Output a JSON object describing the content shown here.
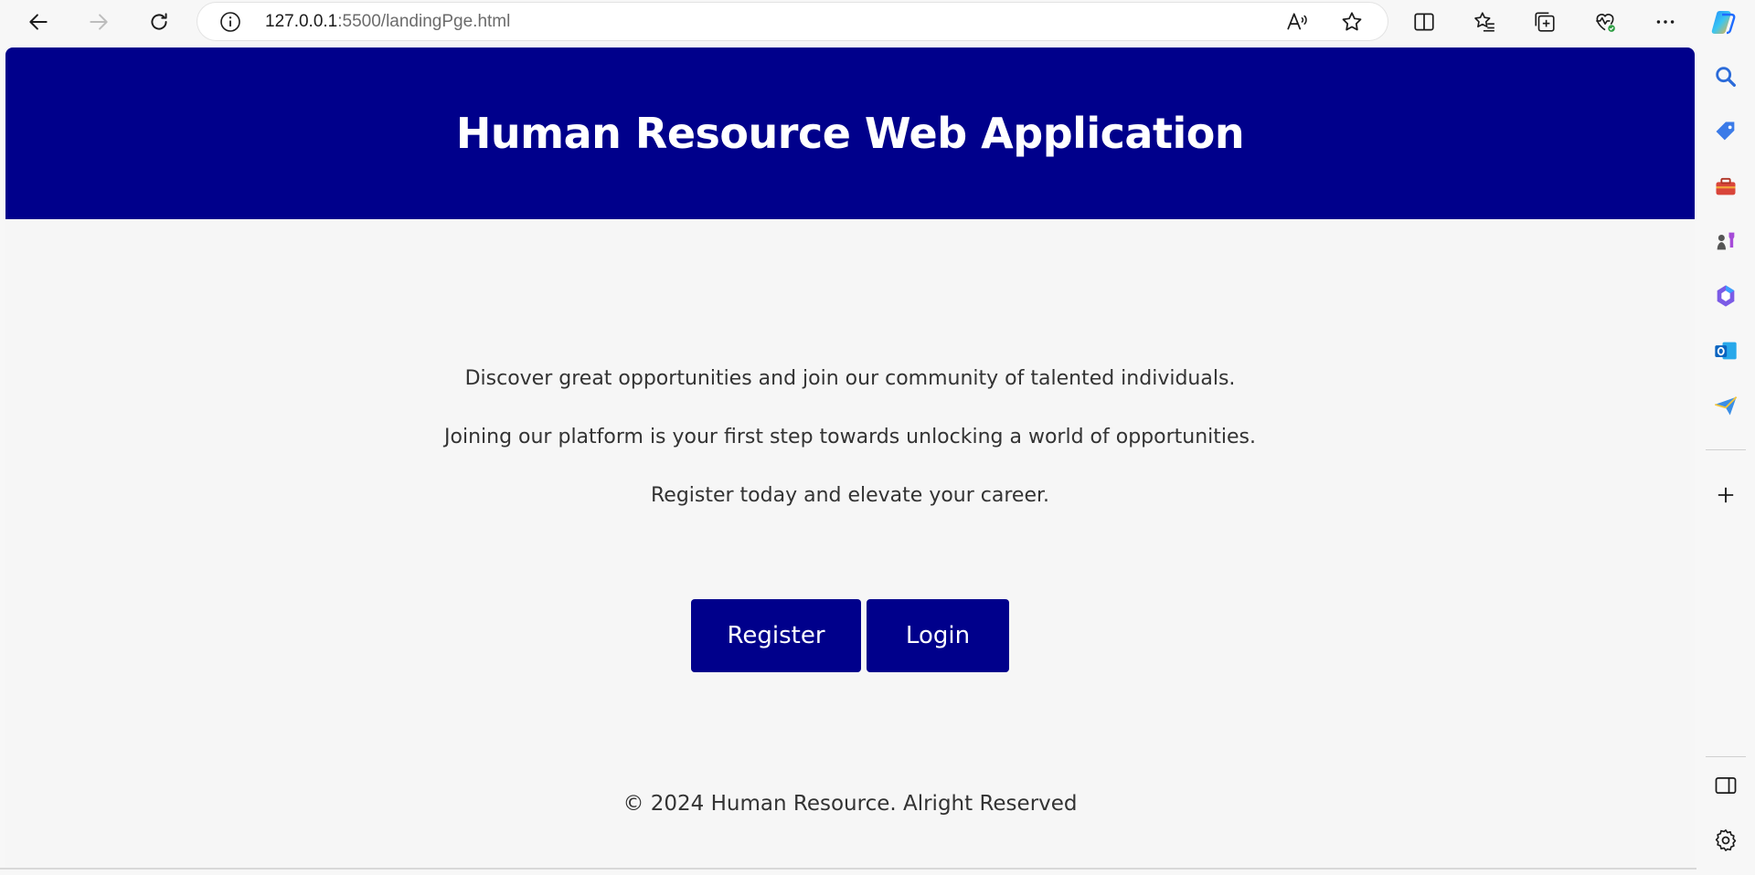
{
  "browser": {
    "url_host": "127.0.0.1",
    "url_path": ":5500/landingPge.html",
    "icons": {
      "back": "back-arrow-icon",
      "forward": "forward-arrow-icon",
      "refresh": "refresh-icon",
      "info": "info-icon",
      "read_aloud": "read-aloud-icon",
      "favorite": "star-icon",
      "split_screen": "split-screen-icon",
      "favorites": "favorites-icon",
      "collections": "collections-icon",
      "browser_essentials": "heart-pulse-icon",
      "more": "more-icon",
      "copilot": "copilot-icon"
    }
  },
  "page": {
    "title": "Human Resource Web Application",
    "lines": [
      "Discover great opportunities and join our community of talented individuals.",
      "Joining our platform is your first step towards unlocking a world of opportunities.",
      "Register today and elevate your career."
    ],
    "register_label": "Register",
    "login_label": "Login",
    "footer": "© 2024 Human Resource. Alright Reserved",
    "colors": {
      "header_bg": "#00008b",
      "button_bg": "#00008b",
      "page_bg": "#f6f6f6"
    }
  },
  "sidebar": {
    "items": [
      "search-icon",
      "shopping-tag-icon",
      "tools-icon",
      "games-icon",
      "microsoft365-icon",
      "outlook-icon",
      "send-icon",
      "add-icon",
      "sidebar-toggle-icon",
      "settings-icon"
    ]
  }
}
